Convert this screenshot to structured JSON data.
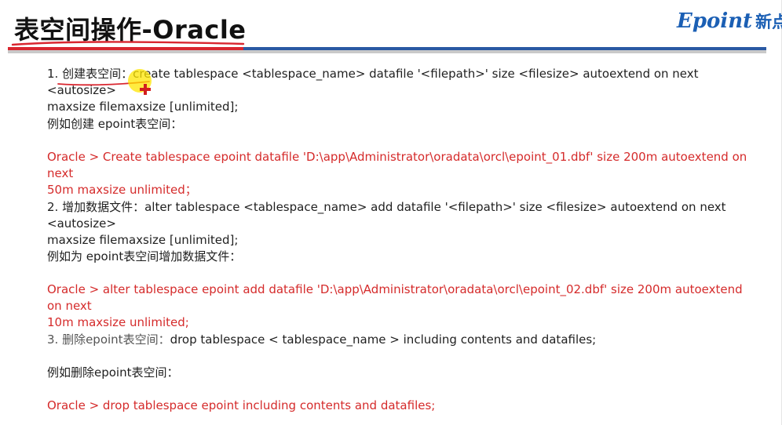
{
  "slide": {
    "title": "表空间操作-Oracle",
    "logo": {
      "brand_latin": "Epoint",
      "brand_cn": "新点"
    },
    "colors": {
      "accent_blue": "#2a59a3",
      "accent_red": "#d9262f",
      "text_red": "#d52b2b",
      "rule_gray": "#c9c9c9"
    },
    "sections": [
      {
        "instruction_lines": [
          "1. 创建表空间：create tablespace <tablespace_name> datafile '<filepath>' size <filesize> autoextend on next <autosize>",
          "maxsize filemaxsize [unlimited];"
        ],
        "example_label": "例如创建 epoint表空间：",
        "example_lines": [
          "Oracle > Create tablespace epoint datafile 'D:\\app\\Administrator\\oradata\\orcl\\epoint_01.dbf' size 200m autoextend on next",
          "50m maxsize unlimited；"
        ]
      },
      {
        "instruction_lines": [
          "2. 增加数据文件：alter tablespace <tablespace_name> add datafile '<filepath>' size <filesize> autoextend on next <autosize>",
          "maxsize filemaxsize [unlimited];"
        ],
        "example_label": "例如为 epoint表空间增加数据文件：",
        "example_lines": [
          "Oracle > alter tablespace epoint add datafile 'D:\\app\\Administrator\\oradata\\orcl\\epoint_02.dbf' size 200m autoextend on next",
          "10m maxsize unlimited;"
        ]
      },
      {
        "instruction_prefix": "3. 删除epoint表空间：",
        "instruction_rest": "drop tablespace < tablespace_name > including contents and datafiles;",
        "example_label": "例如删除epoint表空间：",
        "example_lines": [
          "Oracle > drop tablespace epoint including contents and datafiles;"
        ]
      }
    ]
  }
}
